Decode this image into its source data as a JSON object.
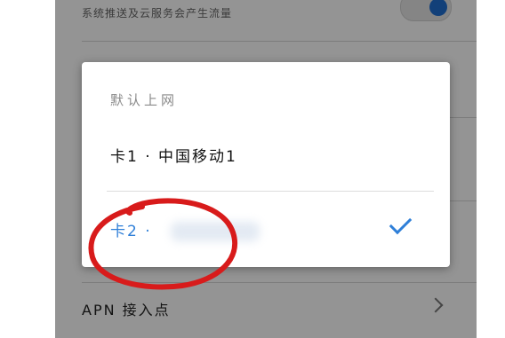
{
  "background": {
    "push_subtitle": "系统推送及云服务会产生流量",
    "apn_label": "APN 接入点"
  },
  "dialog": {
    "title": "默认上网",
    "options": [
      {
        "label": "卡1 · 中国移动1",
        "selected": false
      },
      {
        "label": "卡2 ·",
        "selected": true
      }
    ]
  },
  "colors": {
    "accent": "#2f7fd8",
    "annotation": "#d81b1b",
    "toggle_on": "#1f6fd1"
  },
  "icons": {
    "selected": "check-icon",
    "row_nav": "chevron-right-icon"
  }
}
